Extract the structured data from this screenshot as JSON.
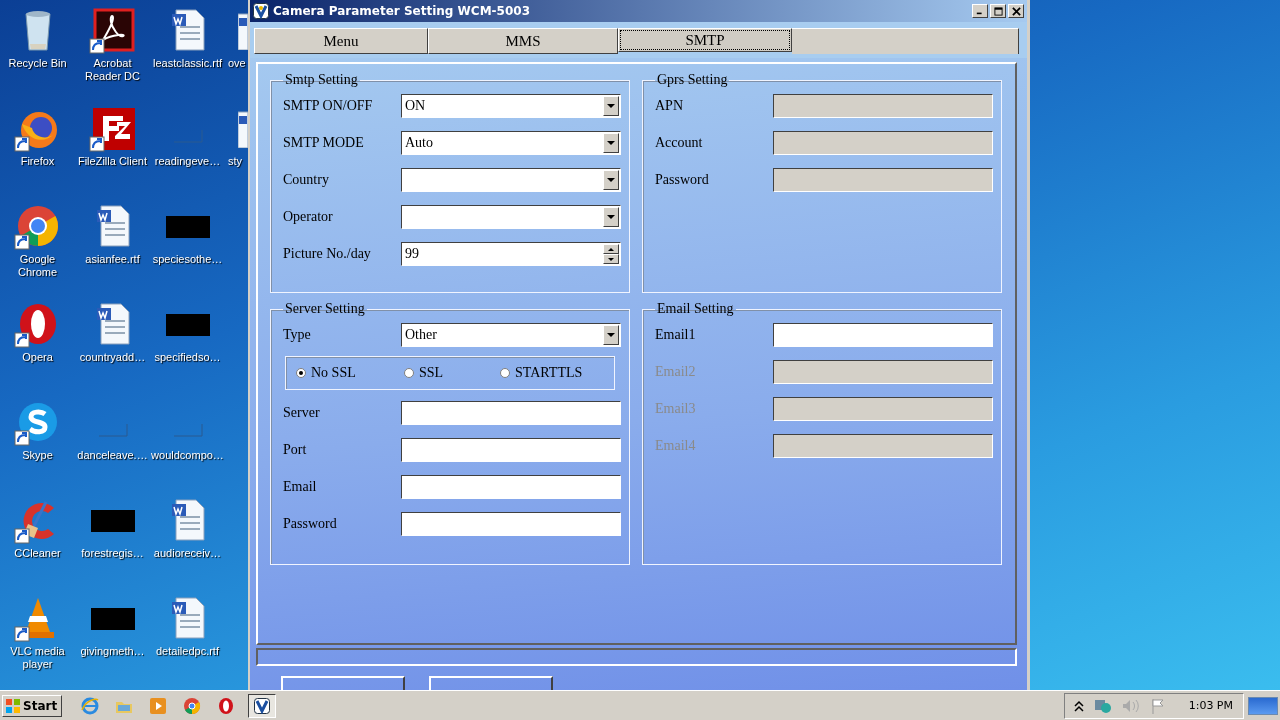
{
  "desktop": {
    "icons": [
      {
        "label": "Recycle Bin",
        "kind": "recycle",
        "shortcut": false,
        "clipped": false
      },
      {
        "label": "Firefox",
        "kind": "firefox",
        "shortcut": true,
        "clipped": false
      },
      {
        "label": "Google Chrome",
        "kind": "chrome",
        "shortcut": true,
        "clipped": false
      },
      {
        "label": "Opera",
        "kind": "opera",
        "shortcut": true,
        "clipped": false
      },
      {
        "label": "Skype",
        "kind": "skype",
        "shortcut": true,
        "clipped": false
      },
      {
        "label": "CCleaner",
        "kind": "ccleaner",
        "shortcut": true,
        "clipped": false
      },
      {
        "label": "VLC media player",
        "kind": "vlc",
        "shortcut": true,
        "clipped": false
      },
      {
        "label": "Acrobat Reader DC",
        "kind": "acrobat",
        "shortcut": true,
        "clipped": false
      },
      {
        "label": "FileZilla Client",
        "kind": "filezilla",
        "shortcut": true,
        "clipped": false
      },
      {
        "label": "asianfee.rtf",
        "kind": "word",
        "shortcut": false,
        "clipped": false
      },
      {
        "label": "countryadd…",
        "kind": "word",
        "shortcut": false,
        "clipped": false
      },
      {
        "label": "danceleave.…",
        "kind": "blank",
        "shortcut": false,
        "clipped": false
      },
      {
        "label": "forestregis…",
        "kind": "black",
        "shortcut": false,
        "clipped": false
      },
      {
        "label": "givingmeth…",
        "kind": "black",
        "shortcut": false,
        "clipped": false
      },
      {
        "label": "leastclassic.rtf",
        "kind": "word",
        "shortcut": false,
        "clipped": false
      },
      {
        "label": "readingeve…",
        "kind": "blank",
        "shortcut": false,
        "clipped": false
      },
      {
        "label": "speciesothe…",
        "kind": "black",
        "shortcut": false,
        "clipped": false
      },
      {
        "label": "specifiedso…",
        "kind": "black",
        "shortcut": false,
        "clipped": false
      },
      {
        "label": "wouldcompo…",
        "kind": "blank",
        "shortcut": false,
        "clipped": false
      },
      {
        "label": "audioreceiv…",
        "kind": "word",
        "shortcut": false,
        "clipped": false
      },
      {
        "label": "detailedpc.rtf",
        "kind": "word",
        "shortcut": false,
        "clipped": false
      },
      {
        "label": "ove",
        "kind": "word",
        "clipped": true
      },
      {
        "label": "sty",
        "kind": "word",
        "clipped": true
      }
    ]
  },
  "window": {
    "title": "Camera Parameter Setting WCM-5003",
    "tabs": [
      {
        "label": "Menu",
        "selected": false
      },
      {
        "label": "MMS",
        "selected": false
      },
      {
        "label": "SMTP",
        "selected": true
      }
    ],
    "groups": [
      {
        "title": "Smtp Setting",
        "rows": [
          {
            "label": "SMTP ON/OFF",
            "kind": "select",
            "value": "ON",
            "label_disabled": false
          },
          {
            "label": "SMTP MODE",
            "kind": "select",
            "value": "Auto",
            "label_disabled": false
          },
          {
            "label": "Country",
            "kind": "select",
            "label_disabled": false
          },
          {
            "label": "Operator",
            "kind": "select",
            "label_disabled": false
          },
          {
            "label": "Picture No./day",
            "kind": "spin",
            "value": "99",
            "label_disabled": false
          }
        ]
      },
      {
        "title": "Gprs Setting",
        "rows": [
          {
            "label": "APN",
            "kind": "text",
            "disabled": true,
            "label_disabled": false
          },
          {
            "label": "Account",
            "kind": "text",
            "disabled": true,
            "label_disabled": false
          },
          {
            "label": "Password",
            "kind": "text",
            "disabled": true,
            "label_disabled": false
          }
        ]
      },
      {
        "title": "Server Setting",
        "rows": [
          {
            "label": "Type",
            "kind": "select",
            "value": "Other",
            "label_disabled": false
          },
          {
            "kind": "radio",
            "options": [
              {
                "label": "No SSL",
                "selected": true
              },
              {
                "label": "SSL",
                "selected": false
              },
              {
                "label": "STARTTLS",
                "selected": false
              }
            ]
          },
          {
            "label": "Server",
            "kind": "text",
            "disabled": false,
            "label_disabled": false
          },
          {
            "label": "Port",
            "kind": "text",
            "disabled": false,
            "label_disabled": false
          },
          {
            "label": "Email",
            "kind": "text",
            "disabled": false,
            "label_disabled": false
          },
          {
            "label": "Password",
            "kind": "text",
            "disabled": false,
            "label_disabled": false
          }
        ]
      },
      {
        "title": "Email Setting",
        "rows": [
          {
            "label": "Email1",
            "kind": "text",
            "disabled": false,
            "label_disabled": false
          },
          {
            "label": "Email2",
            "kind": "text",
            "disabled": true,
            "label_disabled": true
          },
          {
            "label": "Email3",
            "kind": "text",
            "disabled": true,
            "label_disabled": true
          },
          {
            "label": "Email4",
            "kind": "text",
            "disabled": true,
            "label_disabled": true
          }
        ]
      }
    ],
    "buttons": [
      {
        "kind": "button"
      },
      {
        "kind": "button"
      }
    ]
  },
  "taskbar": {
    "start": "Start",
    "quick_launch": [
      {
        "kind": "ie"
      },
      {
        "kind": "folder"
      },
      {
        "kind": "media"
      },
      {
        "kind": "chrome"
      },
      {
        "kind": "opera"
      }
    ],
    "tasks": [
      {
        "kind": "app",
        "selected": true
      }
    ],
    "tray": {
      "time": "1:03 PM"
    }
  }
}
